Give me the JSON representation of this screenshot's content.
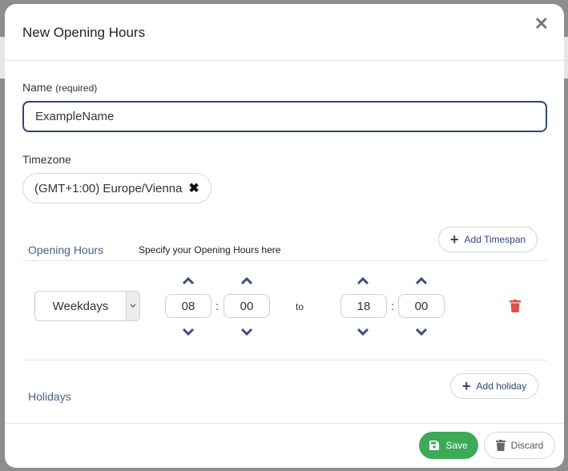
{
  "modal": {
    "title": "New Opening Hours",
    "close_icon": "close-icon"
  },
  "name_field": {
    "label": "Name",
    "required_note": "(required)",
    "value": "ExampleName"
  },
  "timezone": {
    "label": "Timezone",
    "selected": "(GMT+1:00) Europe/Vienna"
  },
  "opening_hours": {
    "title": "Opening Hours",
    "hint": "Specify your Opening Hours here",
    "add_button": "Add Timespan",
    "rows": [
      {
        "day": "Weekdays",
        "from_hour": "08",
        "from_minute": "00",
        "separator": ":",
        "to_label": "to",
        "to_hour": "18",
        "to_minute": "00"
      }
    ]
  },
  "holidays": {
    "title": "Holidays",
    "add_button": "Add holiday"
  },
  "footer": {
    "save_label": "Save",
    "discard_label": "Discard"
  },
  "colors": {
    "accent": "#2f4778",
    "save": "#3caa57",
    "delete": "#d9534f"
  }
}
